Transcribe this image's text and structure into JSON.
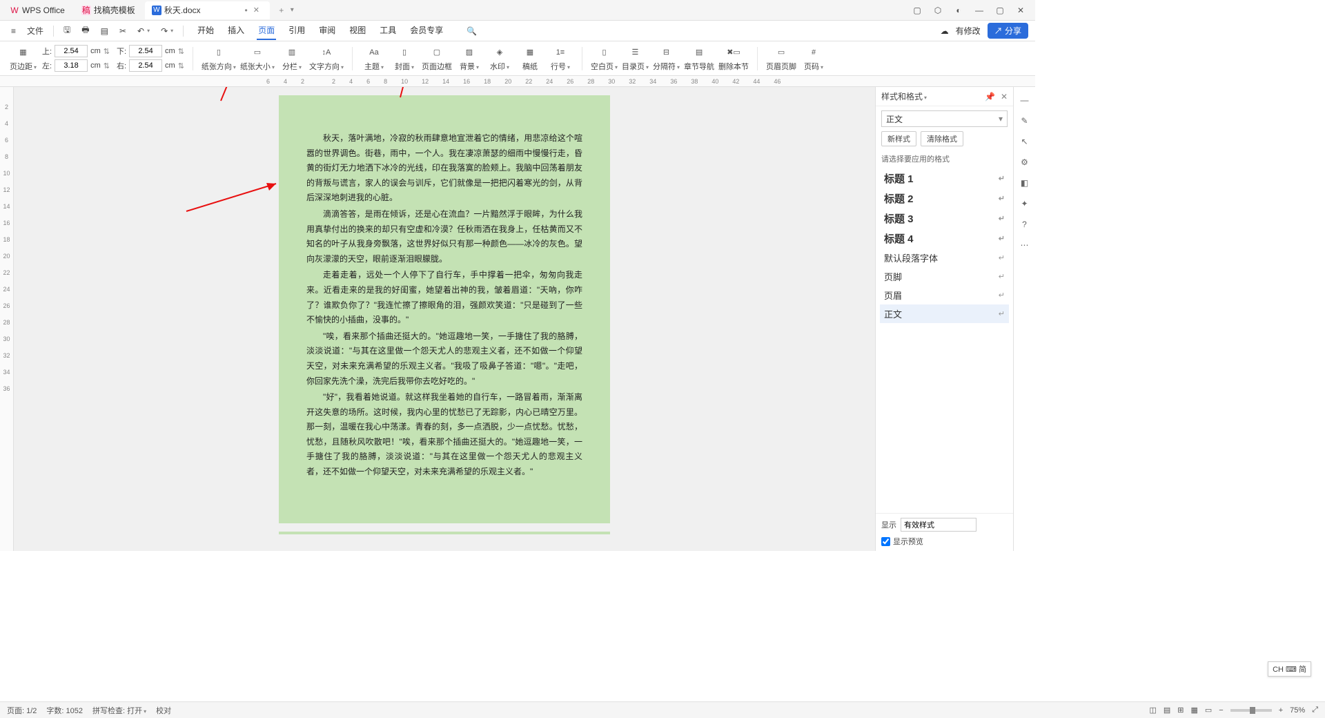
{
  "titlebar": {
    "tabs": [
      {
        "icon": "W",
        "label": "WPS Office",
        "color": "#d14"
      },
      {
        "icon": "稿",
        "label": "找稿壳模板",
        "color": "#d14"
      },
      {
        "icon": "W",
        "label": "秋天.docx",
        "color": "#2b6cdb",
        "dirty": "•"
      }
    ]
  },
  "menubar": {
    "file": "文件",
    "tabs": [
      "开始",
      "插入",
      "页面",
      "引用",
      "审阅",
      "视图",
      "工具",
      "会员专享"
    ],
    "active": "页面",
    "modify": "有修改",
    "share": "分享"
  },
  "ribbon": {
    "margins": {
      "label": "页边距",
      "top_l": "上:",
      "top_v": "2.54",
      "unit": "cm",
      "bot_l": "左:",
      "bot_v": "3.18",
      "r_top_l": "下:",
      "r_top_v": "2.54",
      "r_bot_l": "右:",
      "r_bot_v": "2.54"
    },
    "items": [
      "纸张方向",
      "纸张大小",
      "分栏",
      "文字方向",
      "主题",
      "封面",
      "页面边框",
      "背景",
      "水印",
      "稿纸",
      "行号",
      "空白页",
      "目录页",
      "分隔符",
      "章节导航",
      "删除本节",
      "页眉页脚",
      "页码"
    ]
  },
  "ruler_h": [
    "6",
    "4",
    "2",
    "",
    "2",
    "4",
    "6",
    "8",
    "10",
    "12",
    "14",
    "16",
    "18",
    "20",
    "22",
    "24",
    "26",
    "28",
    "30",
    "32",
    "34",
    "36",
    "38",
    "40",
    "42",
    "44",
    "46"
  ],
  "ruler_v": [
    "",
    "2",
    "4",
    "6",
    "8",
    "10",
    "12",
    "14",
    "16",
    "18",
    "20",
    "22",
    "24",
    "26",
    "28",
    "30",
    "32",
    "34",
    "36"
  ],
  "doc": {
    "p1": "秋天，落叶满地，冷寂的秋雨肆意地宣泄着它的情绪，用悲凉给这个喧嚣的世界调色。街巷，雨中，一个人。我在凄凉萧瑟的细雨中慢慢行走，昏黄的街灯无力地洒下冰冷的光线，印在我落寞的脸颊上。我脑中回荡着朋友的背叛与谎言，家人的误会与训斥，它们就像是一把把闪着寒光的剑，从背后深深地刺进我的心脏。",
    "p2": "滴滴答答，是雨在倾诉，还是心在流血？一片黯然浮于眼眸，为什么我用真挚付出的换来的却只有空虚和冷漠？任秋雨洒在我身上，任枯黄而又不知名的叶子从我身旁飘落，这世界好似只有那一种颜色——冰冷的灰色。望向灰濛濛的天空，眼前逐渐泪眼朦胧。",
    "p3": "走着走着，远处一个人停下了自行车，手中撑着一把伞，匆匆向我走来。近看走来的是我的好闺蜜，她望着出神的我，皱着眉道：\"天吶，你咋了？谁欺负你了？\"我连忙擦了擦眼角的泪，强颜欢笑道：\"只是碰到了一些不愉快的小插曲，没事的。\"",
    "p4": "\"唉，看来那个插曲还挺大的。\"她逗趣地一笑，一手搪住了我的胳膊，淡淡说道：\"与其在这里做一个怨天尤人的悲观主义者，还不如做一个仰望天空，对未来充满希望的乐观主义者。\"我吸了吸鼻子答道：\"嗯\"。\"走吧，你回家先洗个澡，洗完后我带你去吃好吃的。\"",
    "p5": "\"好\"，我看着她说道。就这样我坐着她的自行车，一路冒着雨，渐渐离开这失意的场所。这时候，我内心里的忧愁已了无踪影，内心已晴空万里。那一刻，温暖在我心中荡漾。青春的刻，多一点洒脱，少一点忧愁。忧愁，忧愁，且随秋风吹散吧！\"唉，看来那个插曲还挺大的。\"她逗趣地一笑，一手搪住了我的胳膊，淡淡说道：\"与其在这里做一个怨天尤人的悲观主义者，还不如做一个仰望天空，对未来充满希望的乐观主义者。\""
  },
  "sidepanel": {
    "title": "样式和格式",
    "current": "正文",
    "new_style": "新样式",
    "clear": "清除格式",
    "hint": "请选择要应用的格式",
    "items": [
      {
        "label": "标题 1",
        "cls": "h"
      },
      {
        "label": "标题 2",
        "cls": "h"
      },
      {
        "label": "标题 3",
        "cls": "h"
      },
      {
        "label": "标题 4",
        "cls": "h"
      },
      {
        "label": "默认段落字体",
        "cls": ""
      },
      {
        "label": "页脚",
        "cls": ""
      },
      {
        "label": "页眉",
        "cls": ""
      },
      {
        "label": "正文",
        "cls": "sel"
      }
    ],
    "show": "显示",
    "show_val": "有效样式",
    "preview": "显示预览"
  },
  "status": {
    "page": "页面: 1/2",
    "words": "字数: 1052",
    "spell": "拼写检查: 打开",
    "proof": "校对",
    "zoom": "75%"
  },
  "ime": "CH ⌨ 简"
}
